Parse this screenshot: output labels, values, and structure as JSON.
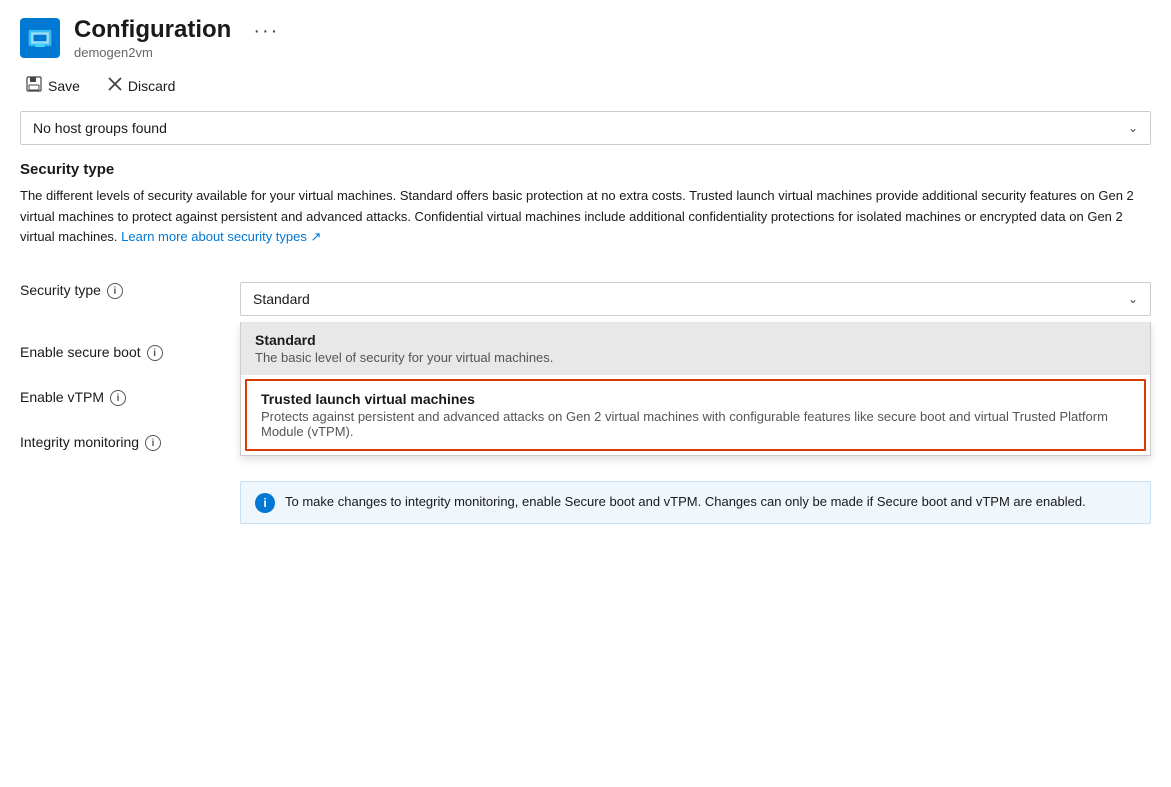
{
  "header": {
    "icon_label": "configuration-icon",
    "title": "Configuration",
    "subtitle": "demogen2vm",
    "menu_label": "···"
  },
  "toolbar": {
    "save_label": "Save",
    "discard_label": "Discard"
  },
  "host_groups_dropdown": {
    "placeholder": "No host groups found",
    "chevron": "∨"
  },
  "security_section": {
    "title": "Security type",
    "description": "The different levels of security available for your virtual machines. Standard offers basic protection at no extra costs. Trusted launch virtual machines provide additional security features on Gen 2 virtual machines to protect against persistent and advanced attacks. Confidential virtual machines include additional confidentiality protections for isolated machines or encrypted data on Gen 2 virtual machines.",
    "learn_more_text": "Learn more about security types",
    "learn_more_icon": "↗"
  },
  "form": {
    "fields": [
      {
        "label": "Security type",
        "has_info": true,
        "value": "Standard"
      },
      {
        "label": "Enable secure boot",
        "has_info": true,
        "value": ""
      },
      {
        "label": "Enable vTPM",
        "has_info": true,
        "value": ""
      },
      {
        "label": "Integrity monitoring",
        "has_info": true,
        "value": ""
      }
    ],
    "dropdown_options": [
      {
        "title": "Standard",
        "description": "The basic level of security for your virtual machines.",
        "selected": true,
        "highlighted": false
      },
      {
        "title": "Trusted launch virtual machines",
        "description": "Protects against persistent and advanced attacks on Gen 2 virtual machines with configurable features like secure boot and virtual Trusted Platform Module (vTPM).",
        "selected": false,
        "highlighted": true
      }
    ]
  },
  "info_bar": {
    "icon": "i",
    "message": "To make changes to integrity monitoring, enable Secure boot and vTPM. Changes can only be made if Secure boot and vTPM are enabled."
  }
}
